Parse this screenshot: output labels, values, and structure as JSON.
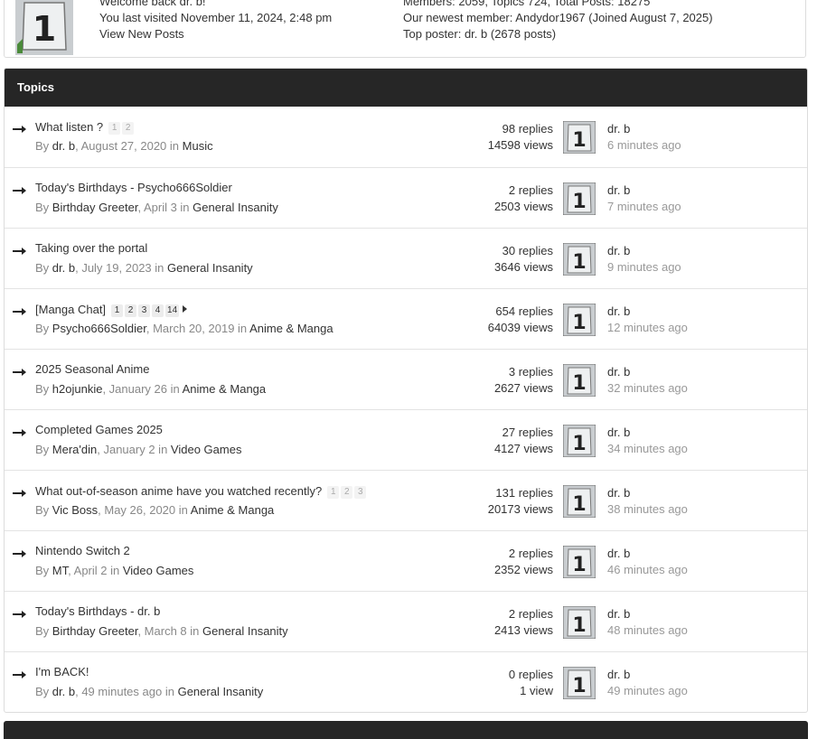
{
  "welcome": {
    "greeting": "Welcome back dr. b!",
    "last_visit": "You last visited November 11, 2024, 2:48 pm",
    "new_posts_link": "View New Posts"
  },
  "board_stats": {
    "summary": "Members: 2059, Topics 724, Total Posts: 18275",
    "newest_label": "Our newest member:",
    "newest_member": "Andydor1967",
    "newest_joined": "(Joined August 7, 2025)",
    "top_poster_label": "Top poster:",
    "top_poster": "dr. b",
    "top_poster_posts": "(2678 posts)"
  },
  "topics_panel": {
    "header": "Topics"
  },
  "topics": [
    {
      "title": "What listen ?",
      "pages": [
        "1",
        "2"
      ],
      "by": "By",
      "author": "dr. b",
      "date": ", August 27, 2020 in",
      "forum": "Music",
      "replies": "98 replies",
      "views": "14598 views",
      "last_user": "dr. b",
      "last_time": "6 minutes ago"
    },
    {
      "title": "Today's Birthdays - Psycho666Soldier",
      "pages": [],
      "by": "By",
      "author": "Birthday Greeter",
      "date": ", April 3 in",
      "forum": "General Insanity",
      "replies": "2 replies",
      "views": "2503 views",
      "last_user": "dr. b",
      "last_time": "7 minutes ago"
    },
    {
      "title": "Taking over the portal",
      "pages": [],
      "by": "By",
      "author": "dr. b",
      "date": ", July 19, 2023 in",
      "forum": "General Insanity",
      "replies": "30 replies",
      "views": "3646 views",
      "last_user": "dr. b",
      "last_time": "9 minutes ago"
    },
    {
      "title": "[Manga Chat]",
      "pages": [
        "1",
        "2",
        "3",
        "4",
        "14"
      ],
      "has_next": true,
      "pages_strong": true,
      "by": "By",
      "author": "Psycho666Soldier",
      "date": ", March 20, 2019 in",
      "forum": "Anime & Manga",
      "replies": "654 replies",
      "views": "64039 views",
      "last_user": "dr. b",
      "last_time": "12 minutes ago"
    },
    {
      "title": "2025 Seasonal Anime",
      "pages": [],
      "by": "By",
      "author": "h2ojunkie",
      "date": ", January 26 in",
      "forum": "Anime & Manga",
      "replies": "3 replies",
      "views": "2627 views",
      "last_user": "dr. b",
      "last_time": "32 minutes ago"
    },
    {
      "title": "Completed Games 2025",
      "pages": [],
      "by": "By",
      "author": "Mera'din",
      "date": ", January 2 in",
      "forum": "Video Games",
      "replies": "27 replies",
      "views": "4127 views",
      "last_user": "dr. b",
      "last_time": "34 minutes ago"
    },
    {
      "title": "What out-of-season anime have you watched recently?",
      "pages": [
        "1",
        "2",
        "3"
      ],
      "by": "By",
      "author": "Vic Boss",
      "date": ", May 26, 2020 in",
      "forum": "Anime & Manga",
      "replies": "131 replies",
      "views": "20173 views",
      "last_user": "dr. b",
      "last_time": "38 minutes ago"
    },
    {
      "title": "Nintendo Switch 2",
      "pages": [],
      "by": "By",
      "author": "MT",
      "date": ", April 2 in",
      "forum": "Video Games",
      "replies": "2 replies",
      "views": "2352 views",
      "last_user": "dr. b",
      "last_time": "46 minutes ago"
    },
    {
      "title": "Today's Birthdays - dr. b",
      "pages": [],
      "by": "By",
      "author": "Birthday Greeter",
      "date": ", March 8 in",
      "forum": "General Insanity",
      "replies": "2 replies",
      "views": "2413 views",
      "last_user": "dr. b",
      "last_time": "48 minutes ago"
    },
    {
      "title": "I'm BACK!",
      "pages": [],
      "by": "By",
      "author": "dr. b",
      "date": ", 49 minutes ago in",
      "forum": "General Insanity",
      "replies": "0 replies",
      "views": "1 view",
      "last_user": "dr. b",
      "last_time": "49 minutes ago"
    }
  ],
  "icons": {
    "topic_arrow": "right-arrow-icon",
    "avatar": "number-one-avatar"
  },
  "colors": {
    "header_bg": "#262626",
    "muted_text": "#888888",
    "border": "#dcdcdc"
  }
}
